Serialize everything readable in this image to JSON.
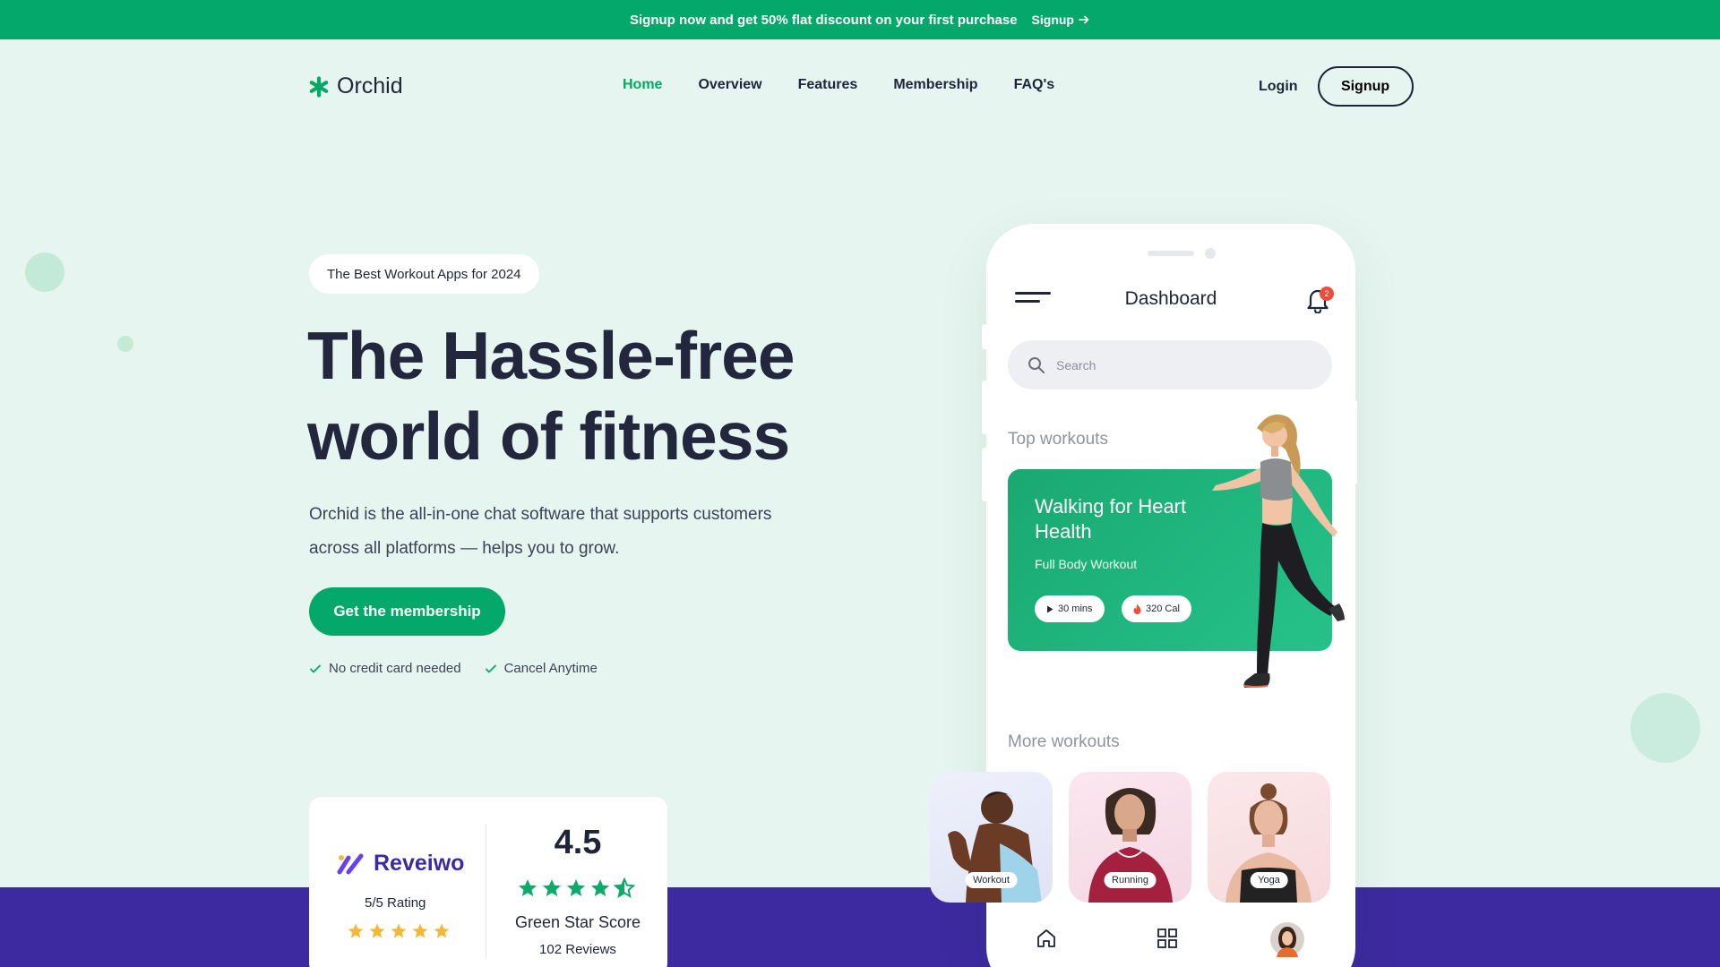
{
  "promo": {
    "text": "Signup now and get 50% flat discount on your first purchase",
    "link": "Signup",
    "link_icon": "arrow-right-icon"
  },
  "nav": {
    "brand": "Orchid",
    "items": [
      {
        "label": "Home",
        "active": true
      },
      {
        "label": "Overview",
        "active": false
      },
      {
        "label": "Features",
        "active": false
      },
      {
        "label": "Membership",
        "active": false
      },
      {
        "label": "FAQ's",
        "active": false
      }
    ],
    "login": "Login",
    "signup": "Signup"
  },
  "hero": {
    "badge": "The Best Workout Apps for 2024",
    "title_line1": "The Hassle-free",
    "title_line2": "world of fitness",
    "subtitle": "Orchid is the all-in-one chat software that supports customers across all platforms — helps you to grow.",
    "cta": "Get the membership",
    "checks": [
      "No credit card needed",
      "Cancel Anytime"
    ]
  },
  "reviews": {
    "brand": "Reveiwo",
    "rating_text": "5/5 Rating",
    "rating_stars": 5,
    "score": "4.5",
    "score_stars": 4.5,
    "score_label": "Green Star Score",
    "review_count": "102 Reviews"
  },
  "phone": {
    "title": "Dashboard",
    "notification_count": "2",
    "search_placeholder": "Search",
    "top_label": "Top workouts",
    "card": {
      "title": "Walking for Heart Health",
      "subtitle": "Full Body Workout",
      "duration": "30 mins",
      "calories": "320 Cal"
    },
    "more_label": "More workouts",
    "more": [
      {
        "label": "Workout"
      },
      {
        "label": "Running"
      },
      {
        "label": "Yoga"
      }
    ],
    "tabbar": [
      "home-icon",
      "grid-icon",
      "profile-avatar"
    ]
  },
  "colors": {
    "brand_green": "#04a86a",
    "background": "#e6f5ef",
    "purple": "#3d2aa0",
    "text": "#1f2438",
    "star_yellow": "#f4b83b",
    "star_green": "#0fa96b"
  }
}
